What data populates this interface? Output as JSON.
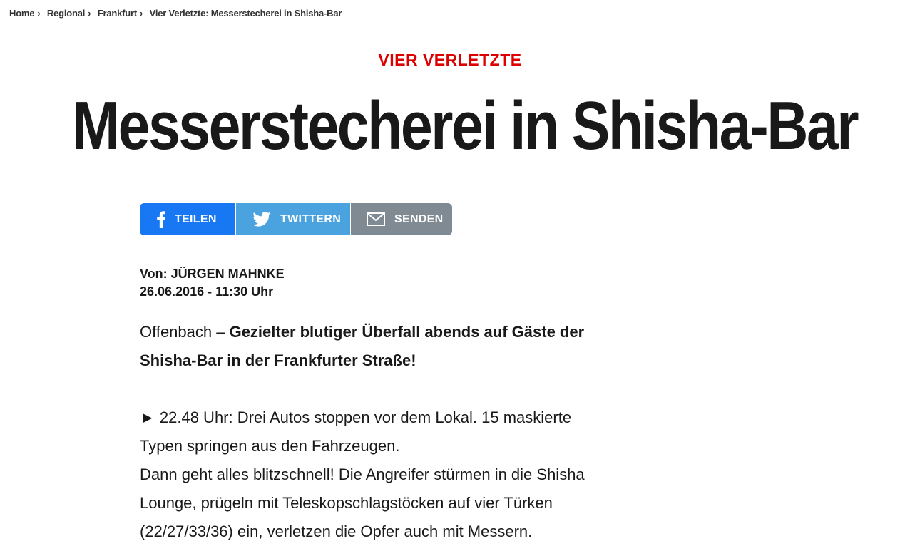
{
  "breadcrumb": {
    "items": [
      "Home",
      "Regional",
      "Frankfurt",
      "Vier Verletzte: Messerstecherei in Shisha-Bar"
    ],
    "separator": "›"
  },
  "article": {
    "kicker": "VIER VERLETZTE",
    "headline": "Messerstecherei in Shisha-Bar",
    "author": "Von: JÜRGEN MAHNKE",
    "date": "26.06.2016 - 11:30 Uhr",
    "lead_location": "Offenbach – ",
    "lead_text": "Gezielter blutiger Überfall abends auf Gäste der Shisha-Bar in der Frankfurter Straße!",
    "paragraph_1": "► 22.48 Uhr: Drei Autos stoppen vor dem Lokal. 15 maskierte Typen springen aus den Fahrzeugen.",
    "paragraph_2": "Dann geht alles blitzschnell! Die Angreifer stürmen in die Shisha Lounge, prügeln mit Teleskopschlagstöcken auf vier Türken (22/27/33/36) ein, verletzen die Opfer auch mit Messern."
  },
  "share": {
    "facebook": {
      "label": "TEILEN",
      "icon": "facebook-icon",
      "color": "#1877f2"
    },
    "twitter": {
      "label": "TWITTERN",
      "icon": "twitter-icon",
      "color": "#4aa3df"
    },
    "mail": {
      "label": "SENDEN",
      "icon": "mail-icon",
      "color": "#7f8a93"
    }
  },
  "colors": {
    "kicker": "#dd0000",
    "text": "#191919"
  }
}
